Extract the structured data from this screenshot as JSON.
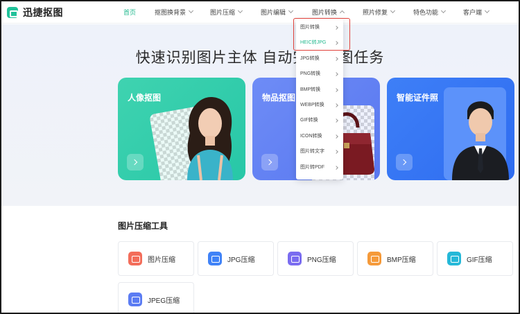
{
  "app": {
    "name": "迅捷抠图"
  },
  "nav": {
    "items": [
      {
        "label": "首页",
        "active": true,
        "chevron": "none"
      },
      {
        "label": "抠图换背景",
        "active": false,
        "chevron": "down"
      },
      {
        "label": "图片压缩",
        "active": false,
        "chevron": "down"
      },
      {
        "label": "图片编辑",
        "active": false,
        "chevron": "down"
      },
      {
        "label": "图片转换",
        "active": false,
        "chevron": "up"
      },
      {
        "label": "照片修复",
        "active": false,
        "chevron": "down"
      },
      {
        "label": "特色功能",
        "active": false,
        "chevron": "down"
      },
      {
        "label": "客户端",
        "active": false,
        "chevron": "down"
      }
    ]
  },
  "dropdown": {
    "items": [
      {
        "label": "图片转换",
        "highlighted": false
      },
      {
        "label": "HEIC转JPG",
        "highlighted": true
      },
      {
        "label": "JPG转换",
        "highlighted": false
      },
      {
        "label": "PNG转换",
        "highlighted": false
      },
      {
        "label": "BMP转换",
        "highlighted": false
      },
      {
        "label": "WEBP转换",
        "highlighted": false
      },
      {
        "label": "GIF转换",
        "highlighted": false
      },
      {
        "label": "ICON转换",
        "highlighted": false
      },
      {
        "label": "图片转文字",
        "highlighted": false
      },
      {
        "label": "图片转PDF",
        "highlighted": false
      }
    ]
  },
  "hero": {
    "title": "快速识别图片主体 自动完成抠图任务",
    "cards": [
      {
        "title": "人像抠图",
        "color": "#2fcaa8",
        "icon": "arrow-right-icon"
      },
      {
        "title": "物品抠图",
        "color": "#6383f3",
        "icon": "arrow-right-icon"
      },
      {
        "title": "智能证件照",
        "color": "#3a78f5",
        "icon": "arrow-right-icon"
      }
    ]
  },
  "tools": {
    "section_title": "图片压缩工具",
    "items": [
      {
        "label": "图片压缩",
        "color": "#f36d5a",
        "icon": "image-compress-icon"
      },
      {
        "label": "JPG压缩",
        "color": "#3f82f7",
        "icon": "jpg-icon"
      },
      {
        "label": "PNG压缩",
        "color": "#7a6cf0",
        "icon": "png-icon"
      },
      {
        "label": "BMP压缩",
        "color": "#f59a3a",
        "icon": "bmp-icon"
      },
      {
        "label": "GIF压缩",
        "color": "#25b8d8",
        "icon": "gif-icon"
      },
      {
        "label": "JPEG压缩",
        "color": "#5b7cf3",
        "icon": "jpeg-icon"
      }
    ]
  },
  "colors": {
    "accent": "#21b88e",
    "highlight_box": "#e0413a"
  }
}
